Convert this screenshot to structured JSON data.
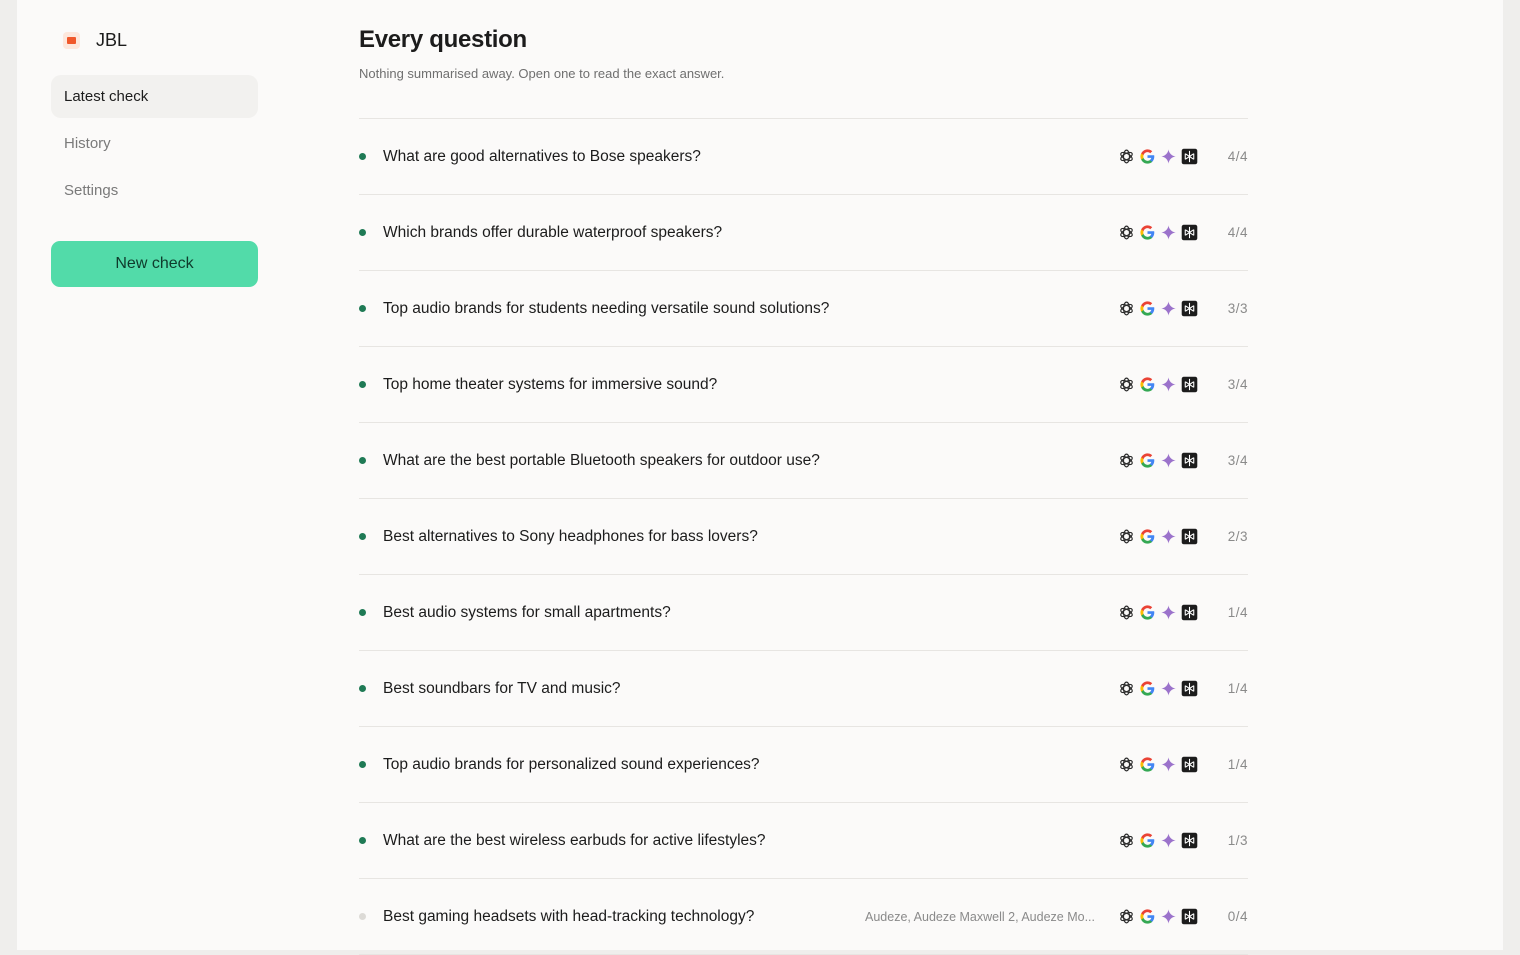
{
  "brand": {
    "name": "JBL",
    "logo_icon": "jbl-logo-icon",
    "logo_color": "#f0582b"
  },
  "sidebar": {
    "items": [
      {
        "label": "Latest check",
        "active": true
      },
      {
        "label": "History",
        "active": false
      },
      {
        "label": "Settings",
        "active": false
      }
    ],
    "new_check_label": "New check",
    "accent": "#52dba9"
  },
  "main": {
    "title": "Every question",
    "subtitle": "Nothing summarised away. Open one to read the exact answer.",
    "engines": [
      "chatgpt-icon",
      "google-icon",
      "gemini-icon",
      "perplexity-icon"
    ],
    "questions": [
      {
        "text": "What are good alternatives to Bose speakers?",
        "score": "4/4",
        "mentioned": ""
      },
      {
        "text": "Which brands offer durable waterproof speakers?",
        "score": "4/4",
        "mentioned": ""
      },
      {
        "text": "Top audio brands for students needing versatile sound solutions?",
        "score": "3/3",
        "mentioned": ""
      },
      {
        "text": "Top home theater systems for immersive sound?",
        "score": "3/4",
        "mentioned": ""
      },
      {
        "text": "What are the best portable Bluetooth speakers for outdoor use?",
        "score": "3/4",
        "mentioned": ""
      },
      {
        "text": "Best alternatives to Sony headphones for bass lovers?",
        "score": "2/3",
        "mentioned": ""
      },
      {
        "text": "Best audio systems for small apartments?",
        "score": "1/4",
        "mentioned": ""
      },
      {
        "text": "Best soundbars for TV and music?",
        "score": "1/4",
        "mentioned": ""
      },
      {
        "text": "Top audio brands for personalized sound experiences?",
        "score": "1/4",
        "mentioned": ""
      },
      {
        "text": "What are the best wireless earbuds for active lifestyles?",
        "score": "1/3",
        "mentioned": ""
      },
      {
        "text": "Best gaming headsets with head-tracking technology?",
        "score": "0/4",
        "mentioned": "Audeze, Audeze Maxwell 2, Audeze Mo..."
      }
    ]
  },
  "colors": {
    "dot_active": "#1f7a55",
    "dot_zero": "#dcdad6"
  }
}
